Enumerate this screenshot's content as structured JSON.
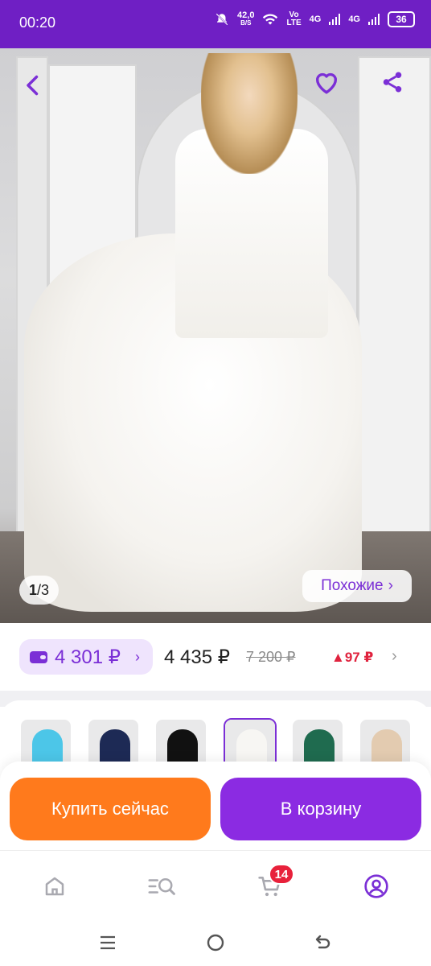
{
  "status_bar": {
    "time": "00:20",
    "net_speed_value": "42,0",
    "net_speed_unit": "B/S",
    "volte_top": "Vo",
    "volte_bottom": "LTE",
    "net1": "4G",
    "net2": "4G",
    "battery": "36",
    "icons": [
      "mute-icon",
      "wifi-icon",
      "signal-icon",
      "battery-icon"
    ]
  },
  "gallery": {
    "current": "1",
    "separator": "/",
    "total": "3",
    "similar_label": "Похожие",
    "similar_chevron": "›",
    "icons": [
      "back-arrow-icon",
      "heart-icon",
      "share-icon"
    ]
  },
  "price": {
    "wallet_price": "4 301 ₽",
    "wallet_chevron": "›",
    "current_price": "4 435 ₽",
    "old_price": "7 200 ₽",
    "change": "▲97 ₽",
    "chevron": "›"
  },
  "thumbnails": [
    {
      "color": "#4cc6e8",
      "selected": false
    },
    {
      "color": "#1d2a55",
      "selected": false
    },
    {
      "color": "#111111",
      "selected": false
    },
    {
      "color": "#f7f6f3",
      "selected": true
    },
    {
      "color": "#1f6b4f",
      "selected": false
    },
    {
      "color": "#e3cbb0",
      "selected": false
    }
  ],
  "actions": {
    "buy_now": "Купить сейчас",
    "add_to_cart": "В корзину"
  },
  "tabbar": {
    "items": [
      "home-icon",
      "catalog-search-icon",
      "cart-icon",
      "profile-icon"
    ],
    "cart_badge": "14"
  },
  "system_nav": [
    "recent-apps-icon",
    "home-circle-icon",
    "back-icon"
  ],
  "colors": {
    "brand_purple": "#6f1fc4",
    "accent_purple": "#8b2be2",
    "buy_orange": "#ff7a1c",
    "badge_red": "#e8213b",
    "delta_red": "#e0233e"
  }
}
